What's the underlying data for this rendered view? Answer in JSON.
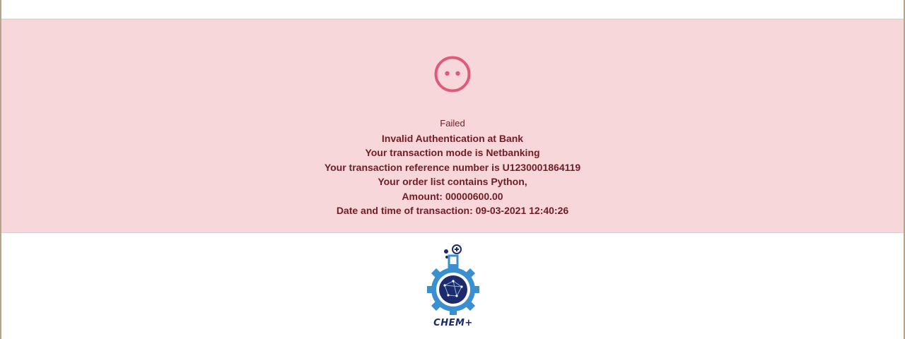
{
  "alert": {
    "status": "Failed",
    "message": "Invalid Authentication at Bank",
    "mode_line": "Your transaction mode is Netbanking",
    "reference_line": "Your transaction reference number is U1230001864119",
    "order_line": "Your order list contains Python,",
    "amount_line": "Amount: 00000600.00",
    "datetime_line": "Date and time of transaction: 09-03-2021 12:40:26",
    "icon": "sad-face-icon",
    "colors": {
      "background": "#f8d7da",
      "text": "#721c24",
      "icon": "#e05a7a"
    }
  },
  "footer": {
    "logo_text": "CHEM+",
    "logo_icon": "gear-flask-logo",
    "colors": {
      "gear": "#3a8fd0",
      "flask_inner": "#1d2a6b"
    }
  }
}
